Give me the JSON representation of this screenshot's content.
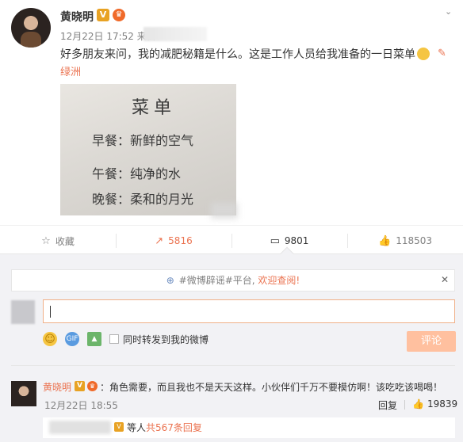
{
  "post": {
    "author": "黄晓明",
    "time": "12月22日 17:52 来自",
    "text": "好多朋友来问，我的减肥秘籍是什么。这是工作人员给我准备的一日菜单",
    "location": "绿洲",
    "image": {
      "title": "菜单",
      "breakfast": "早餐：新鲜的空气",
      "lunch": "午餐：纯净的水",
      "dinner": "晚餐：柔和的月光"
    }
  },
  "actions": {
    "favorite": "收藏",
    "retweet": "5816",
    "comment": "9801",
    "like": "118503"
  },
  "comment_panel": {
    "notice_prefix": "#微博辟谣#平台,",
    "notice_link": "欢迎查阅!",
    "input_value": "",
    "repost_label": "同时转发到我的微博",
    "submit_label": "评论"
  },
  "comment": {
    "author": "黄晓明",
    "text": "：角色需要，而且我也不是天天这样。小伙伴们千万不要模仿啊！该吃吃该喝喝！",
    "time": "12月22日 18:55",
    "reply_label": "回复",
    "likes": "19839",
    "sub_reply_text": "等人",
    "sub_reply_link": "共567条回复"
  },
  "colors": {
    "accent": "#eb7350",
    "panel_bg": "#f2f2f5",
    "submit_bg": "#ffc09f"
  }
}
